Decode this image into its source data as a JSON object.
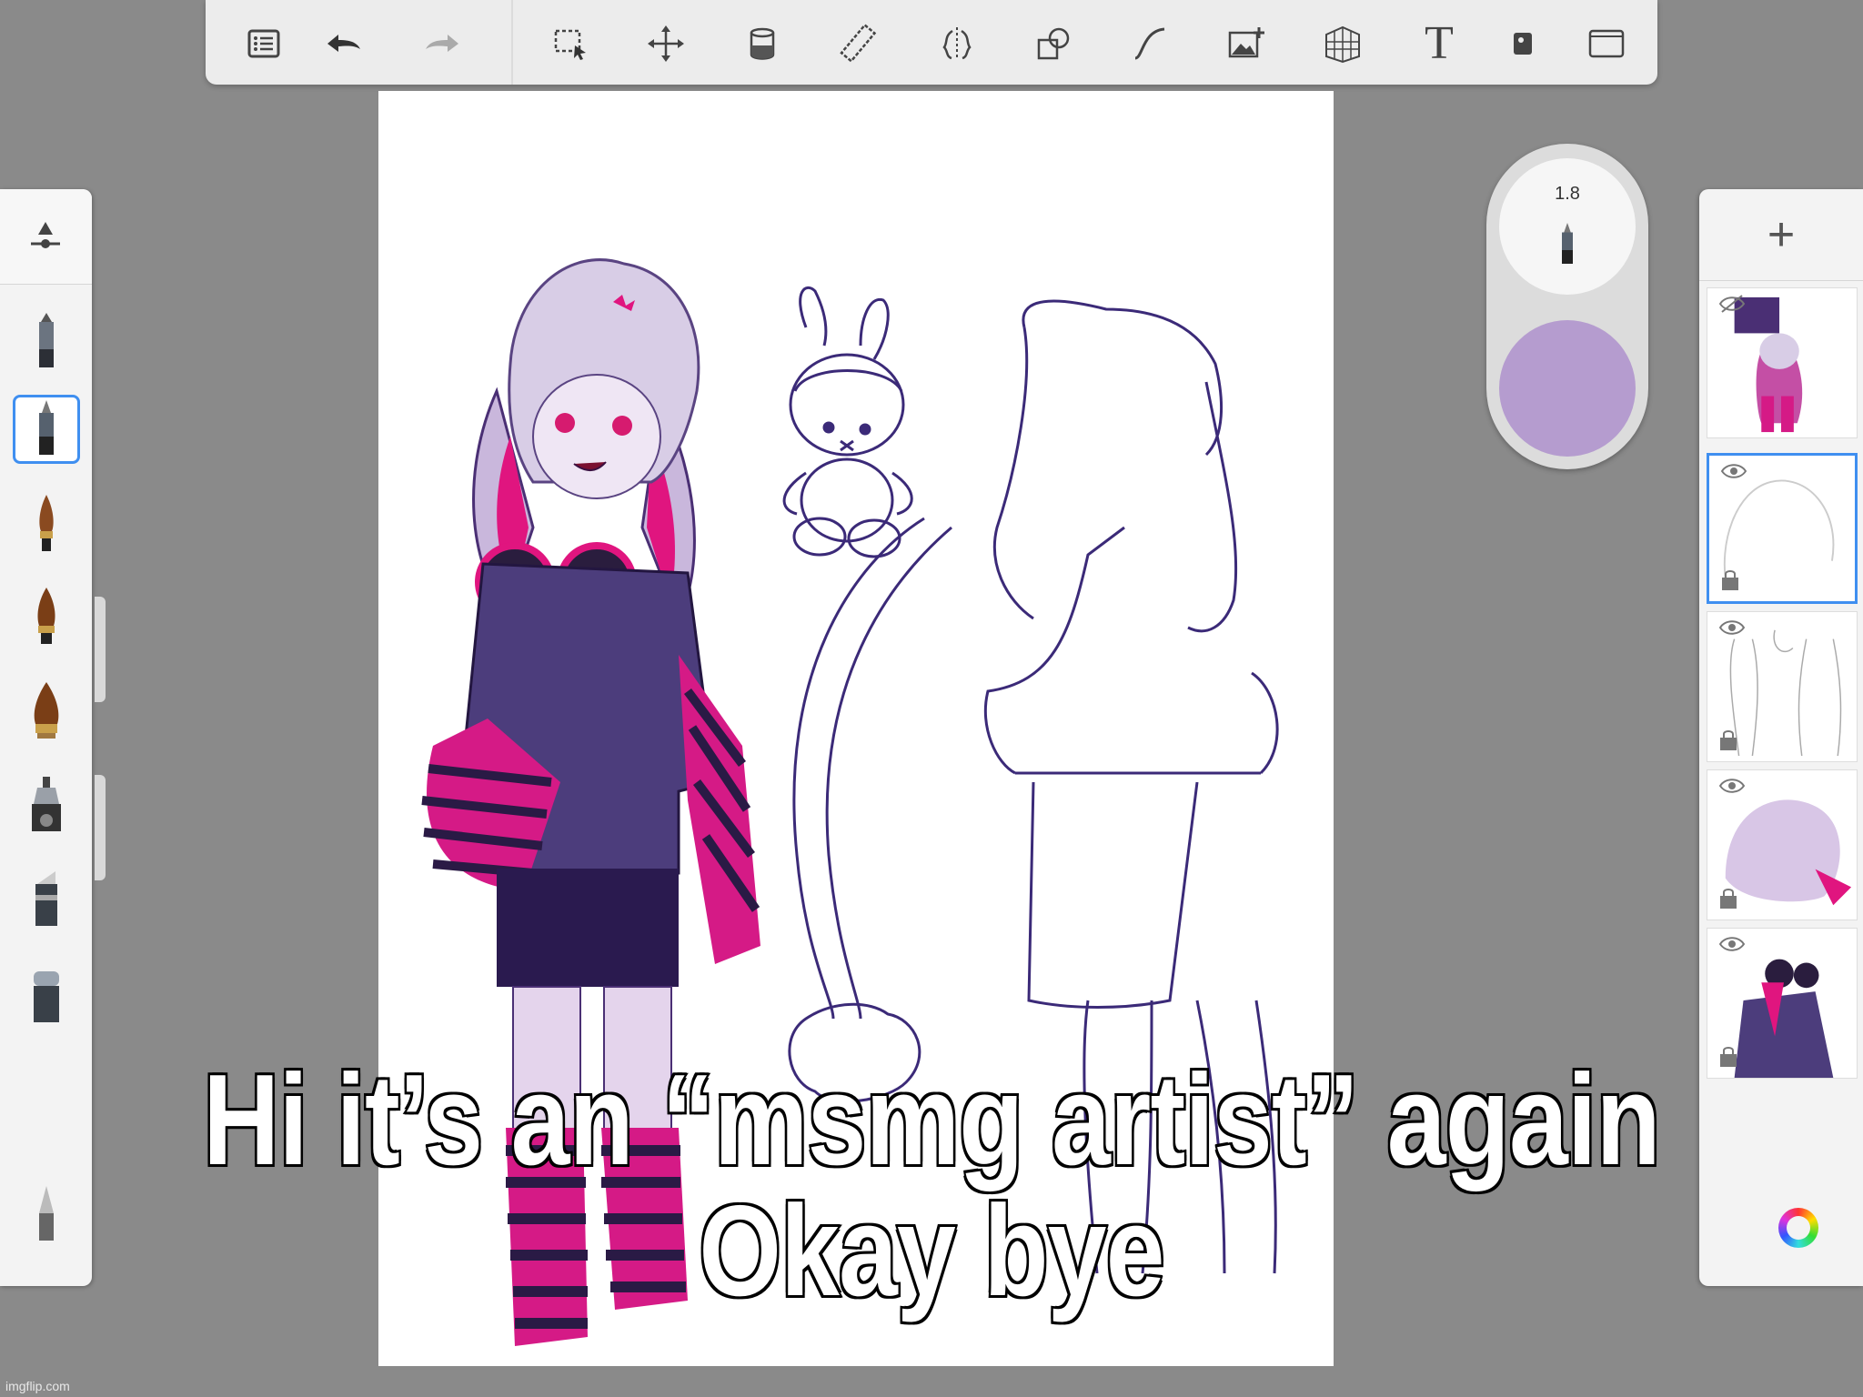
{
  "toolbar": {
    "icons": [
      "list-icon",
      "undo-icon",
      "redo-icon",
      "selection-icon",
      "transform-icon",
      "fill-icon",
      "ruler-icon",
      "symmetry-icon",
      "shapes-icon",
      "curve-icon",
      "add-image-icon",
      "perspective-icon",
      "text-icon",
      "stencil-icon",
      "fullscreen-icon"
    ],
    "text_tool_label": "T"
  },
  "brush_size": {
    "value": "1.8"
  },
  "current_color": "#b59ccf",
  "layers": {
    "add_label": "+",
    "count": 5
  },
  "caption": {
    "line1": "Hi it’s an “msmg artist” again",
    "line2": "Okay bye"
  },
  "watermark": "imgflip.com"
}
